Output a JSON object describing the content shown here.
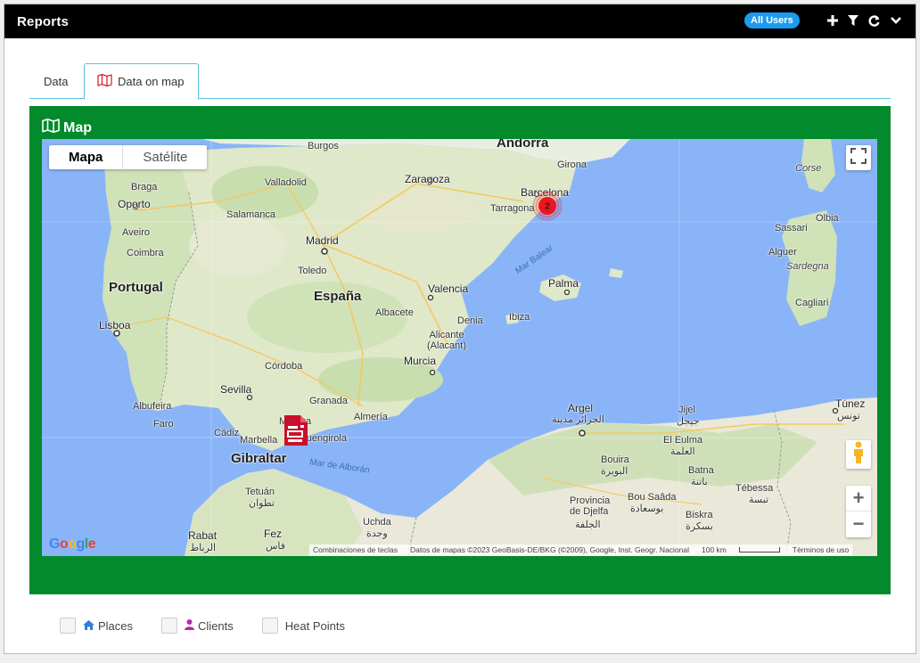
{
  "header": {
    "title": "Reports",
    "badge": "All Users"
  },
  "tabs": [
    {
      "label": "Data"
    },
    {
      "label": "Data on map"
    }
  ],
  "panel": {
    "title": "Map"
  },
  "map": {
    "type_buttons": {
      "map": "Mapa",
      "satellite": "Satélite"
    },
    "cluster_count": "2",
    "labels": {
      "andorra": "Andorra",
      "burgos": "Burgos",
      "girona": "Girona",
      "zaragoza": "Zaragoza",
      "barcelona": "Barcelona",
      "tarragona": "Tarragona",
      "valladolid": "Valladolid",
      "braga": "Braga",
      "oporto": "Oporto",
      "salamanca": "Salamanca",
      "aveiro": "Aveiro",
      "coimbra": "Coimbra",
      "madrid": "Madrid",
      "toledo": "Toledo",
      "portugal": "Portugal",
      "espana": "España",
      "valencia": "Valencia",
      "palma": "Palma",
      "ibiza": "Ibiza",
      "denia": "Denia",
      "albacete": "Albacete",
      "alicante": "Alicante\n(Alacant)",
      "lisboa": "Lisboa",
      "murcia": "Murcia",
      "cordoba": "Córdoba",
      "sevilla": "Sevilla",
      "granada": "Granada",
      "almeria": "Almería",
      "albufeira": "Albufeira",
      "faro": "Faro",
      "cadiz": "Cádiz",
      "marbella": "Marbella",
      "malaga": "Málaga",
      "fuengirola": "Fuengirola",
      "gibraltar": "Gibraltar",
      "tetuan": "Tetuán",
      "tetuan_ar": "تطوان",
      "rabat": "Rabat",
      "rabat_ar": "الرباط",
      "fez": "Fez",
      "fez_ar": "فاس",
      "uchda": "Uchda",
      "uchda_ar": "وجدة",
      "argel": "Argel",
      "argel_ar": "الجزائر مدينة",
      "bouira": "Bouira",
      "bouira_ar": "البويرة",
      "djelfa": "Provincia\nde Djelfa",
      "djelfa_ar": "الجلفة",
      "bousaada": "Bou Saâda",
      "bousaada_ar": "بوسعادة",
      "eleulma": "El Eulma",
      "eleulma_ar": "العلمة",
      "batna": "Batna",
      "batna_ar": "باتنة",
      "biskra": "Biskra",
      "biskra_ar": "بسكرة",
      "tebessa": "Tébessa",
      "tebessa_ar": "تبسة",
      "jijel": "Jijel",
      "jijel_ar": "جيجل",
      "tunez": "Túnez",
      "tunez_ar": "تونس",
      "corse": "Corse",
      "olbia": "Olbia",
      "sassari": "Sassari",
      "alguer": "Alguer",
      "sardegna": "Sardegna",
      "cagliari": "Cagliari",
      "mar_balear": "Mar Balear",
      "mar_alboran": "Mar de Alborán"
    },
    "footer": {
      "shortcuts": "Combinaciones de teclas",
      "attribution": "Datos de mapas ©2023 GeoBasis-DE/BKG (©2009), Google, Inst. Geogr. Nacional",
      "scale": "100 km",
      "terms": "Términos de uso"
    },
    "logo": "Google"
  },
  "legend": [
    {
      "label": "Places"
    },
    {
      "label": "Clients"
    },
    {
      "label": "Heat Points"
    }
  ],
  "colors": {
    "panel": "#028a2c",
    "badge": "#1a9bf0",
    "tab_border": "#5bc0de",
    "cluster": "#f0141e",
    "marker": "#c8102e"
  }
}
